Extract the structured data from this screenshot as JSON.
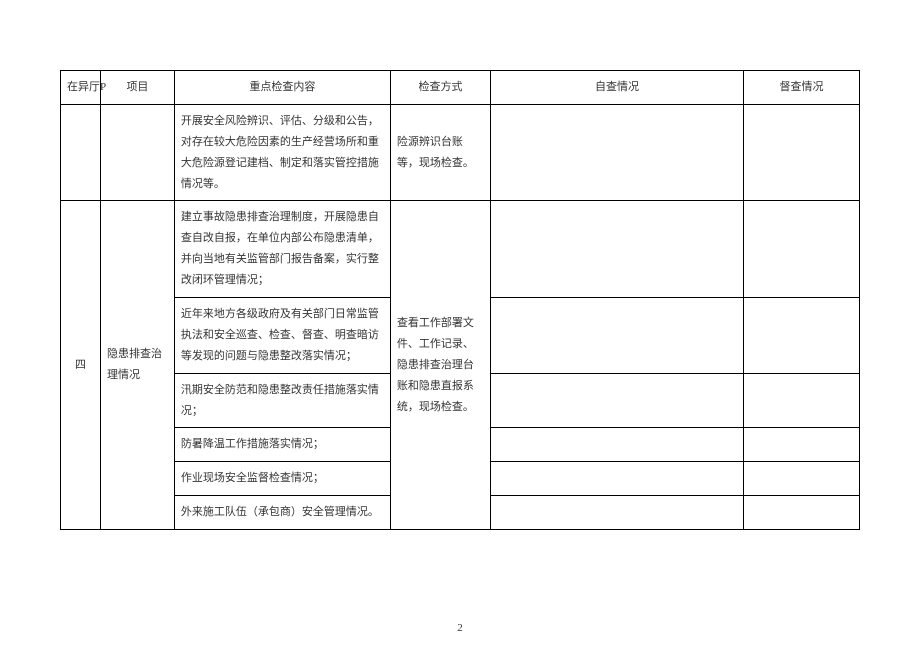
{
  "header": {
    "col0": "在异厅P",
    "col1": "项目",
    "col2": "重点检查内容",
    "col3": "检查方式",
    "col4": "自查情况",
    "col5": "督查情况"
  },
  "section1": {
    "content_a": "开展安全风险辨识、评估、分级和公告，对存在较大危险因素的生产经营场所和重大危险源登记建档、制定和落实管控措施情况等。",
    "method_a": "险源辨识台账等，现场检查。"
  },
  "section4": {
    "index": "四",
    "item": "隐患排查治理情况",
    "method": "查看工作部署文件、工作记录、隐患排查治理台账和隐患直报系统，现场检查。",
    "rows": [
      "建立事故隐患排查治理制度，开展隐患自查自改自报，在单位内部公布隐患清单，并向当地有关监管部门报告备案，实行整改闭环管理情况；",
      "近年来地方各级政府及有关部门日常监管执法和安全巡查、检查、督查、明查暗访等发现的问题与隐患整改落实情况；",
      "汛期安全防范和隐患整改责任措施落实情况；",
      "防暑降温工作措施落实情况；",
      "作业现场安全监督检查情况；",
      "外来施工队伍（承包商）安全管理情况。"
    ]
  },
  "page_number": "2"
}
